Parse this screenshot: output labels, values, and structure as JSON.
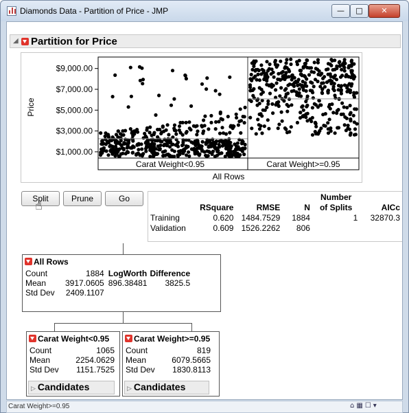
{
  "window": {
    "title": "Diamonds Data - Partition of Price - JMP",
    "min_glyph": "—",
    "max_glyph": "□",
    "close_glyph": "✕"
  },
  "report": {
    "title": "Partition for Price"
  },
  "chart_data": {
    "type": "scatter",
    "ylabel": "Price",
    "yticks": [
      "$9,000.00",
      "$7,000.00",
      "$5,000.00",
      "$3,000.00",
      "$1,000.00"
    ],
    "ytick_values": [
      9000,
      7000,
      5000,
      3000,
      1000
    ],
    "ylim": [
      400,
      10100
    ],
    "groups": [
      "Carat Weight<0.95",
      "Carat Weight>=0.95"
    ],
    "root_label": "All Rows",
    "group_means": [
      2254.0629,
      6079.5665
    ],
    "group_counts": [
      1065,
      819
    ],
    "grid": false,
    "point_color": "#000000"
  },
  "buttons": {
    "split": "Split",
    "prune": "Prune",
    "go": "Go"
  },
  "stats": {
    "headers": [
      "",
      "RSquare",
      "RMSE",
      "N",
      "Number of Splits",
      "AICc"
    ],
    "header_top": "Number",
    "header_bottom": "of Splits",
    "rows": [
      [
        "Training",
        "0.620",
        "1484.7529",
        "1884",
        "1",
        "32870.3"
      ],
      [
        "Validation",
        "0.609",
        "1526.2262",
        "806",
        "",
        ""
      ]
    ]
  },
  "root_node": {
    "title": "All Rows",
    "count_label": "Count",
    "count": "1884",
    "mean_label": "Mean",
    "mean": "3917.0605",
    "std_label": "Std Dev",
    "std": "2409.1107",
    "logworth_label": "LogWorth",
    "logworth": "896.38481",
    "difference_label": "Difference",
    "difference": "3825.5"
  },
  "left_node": {
    "title": "Carat Weight<0.95",
    "count_label": "Count",
    "count": "1065",
    "mean_label": "Mean",
    "mean": "2254.0629",
    "std_label": "Std Dev",
    "std": "1151.7525",
    "candidates": "Candidates"
  },
  "right_node": {
    "title": "Carat Weight>=0.95",
    "count_label": "Count",
    "count": "819",
    "mean_label": "Mean",
    "mean": "6079.5665",
    "std_label": "Std Dev",
    "std": "1830.8113",
    "candidates": "Candidates"
  },
  "statusbar": {
    "text": "Carat Weight>=0.95"
  },
  "icons": [
    "disclosure-open-icon",
    "red-triangle-menu-icon",
    "hand-cursor-icon",
    "home-icon",
    "table-icon",
    "checkbox-icon",
    "dropdown-arrow-icon"
  ]
}
